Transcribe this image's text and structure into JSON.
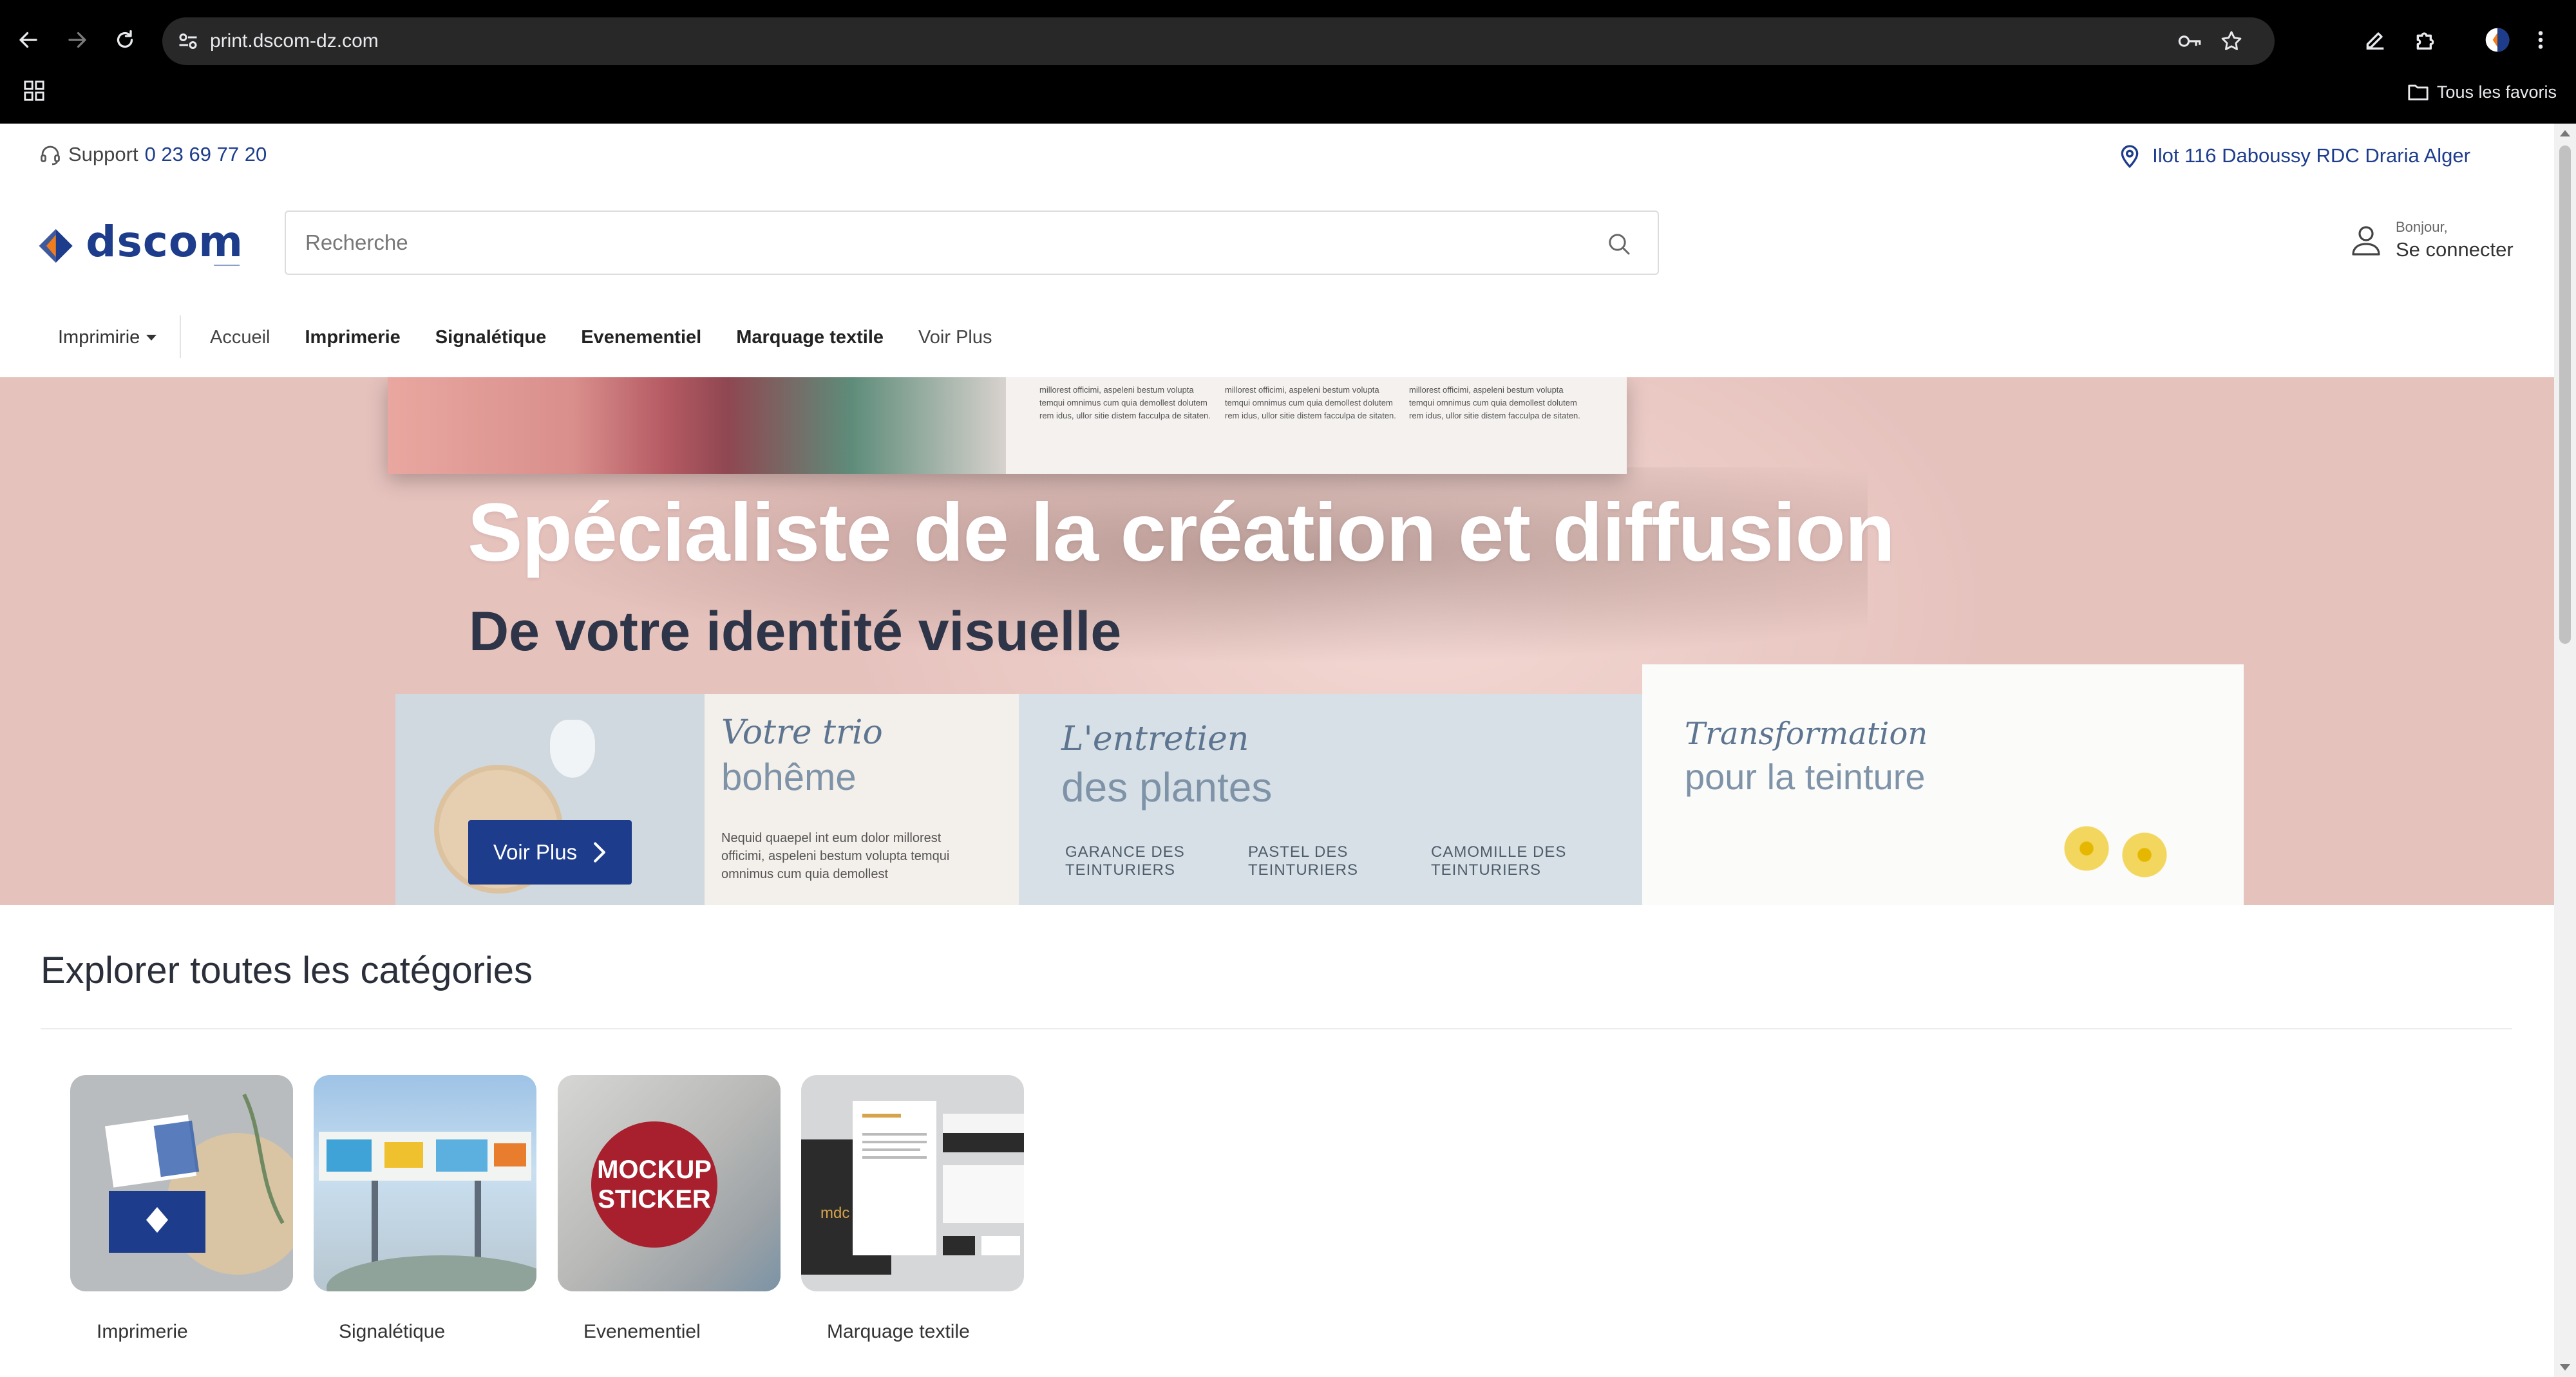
{
  "browser": {
    "url": "print.dscom-dz.com",
    "favorites_label": "Tous les favoris"
  },
  "topbar": {
    "support_label": "Support",
    "support_phone": "0 23 69 77 20",
    "address": "Ilot 116 Daboussy RDC Draria Alger"
  },
  "header": {
    "logo_text": "dscom",
    "search_placeholder": "Recherche",
    "account_greeting": "Bonjour,",
    "account_action": "Se connecter"
  },
  "nav": {
    "category_dropdown": "Imprimirie",
    "links": [
      "Accueil",
      "Imprimerie",
      "Signalétique",
      "Evenementiel",
      "Marquage textile",
      "Voir Plus"
    ]
  },
  "hero": {
    "title": "Spécialiste de la création et diffusion",
    "subtitle": "De votre identité visuelle",
    "cta_label": "Voir Plus",
    "brochure": {
      "panel1_script": "Votre trio",
      "panel1_thin": "bohême",
      "panel1_para": "Nequid quaepel int eum dolor millorest officimi, aspeleni bestum volupta temqui omnimus cum quia demollest",
      "panel2_script": "L'entretien",
      "panel2_thin": "des plantes",
      "panel2_items": [
        "GARANCE DES TEINTURIERS",
        "PASTEL DES TEINTURIERS",
        "CAMOMILLE DES TEINTURIERS"
      ],
      "panel3_script": "Transformation",
      "panel3_thin": "pour la teinture",
      "top_text": "millorest officimi, aspeleni bestum volupta temqui omnimus cum quia demollest dolutem rem idus, ullor sitie distem facculpa de sitaten."
    }
  },
  "categories": {
    "title": "Explorer toutes les catégories",
    "items": [
      {
        "label": "Imprimerie"
      },
      {
        "label": "Signalétique"
      },
      {
        "label": "Evenementiel",
        "image_text": "MOCKUP STICKER"
      },
      {
        "label": "Marquage textile"
      }
    ]
  },
  "colors": {
    "brand_blue": "#1d3c8c",
    "brand_orange": "#f07d1a",
    "hero_bg": "#e6c2bd"
  }
}
